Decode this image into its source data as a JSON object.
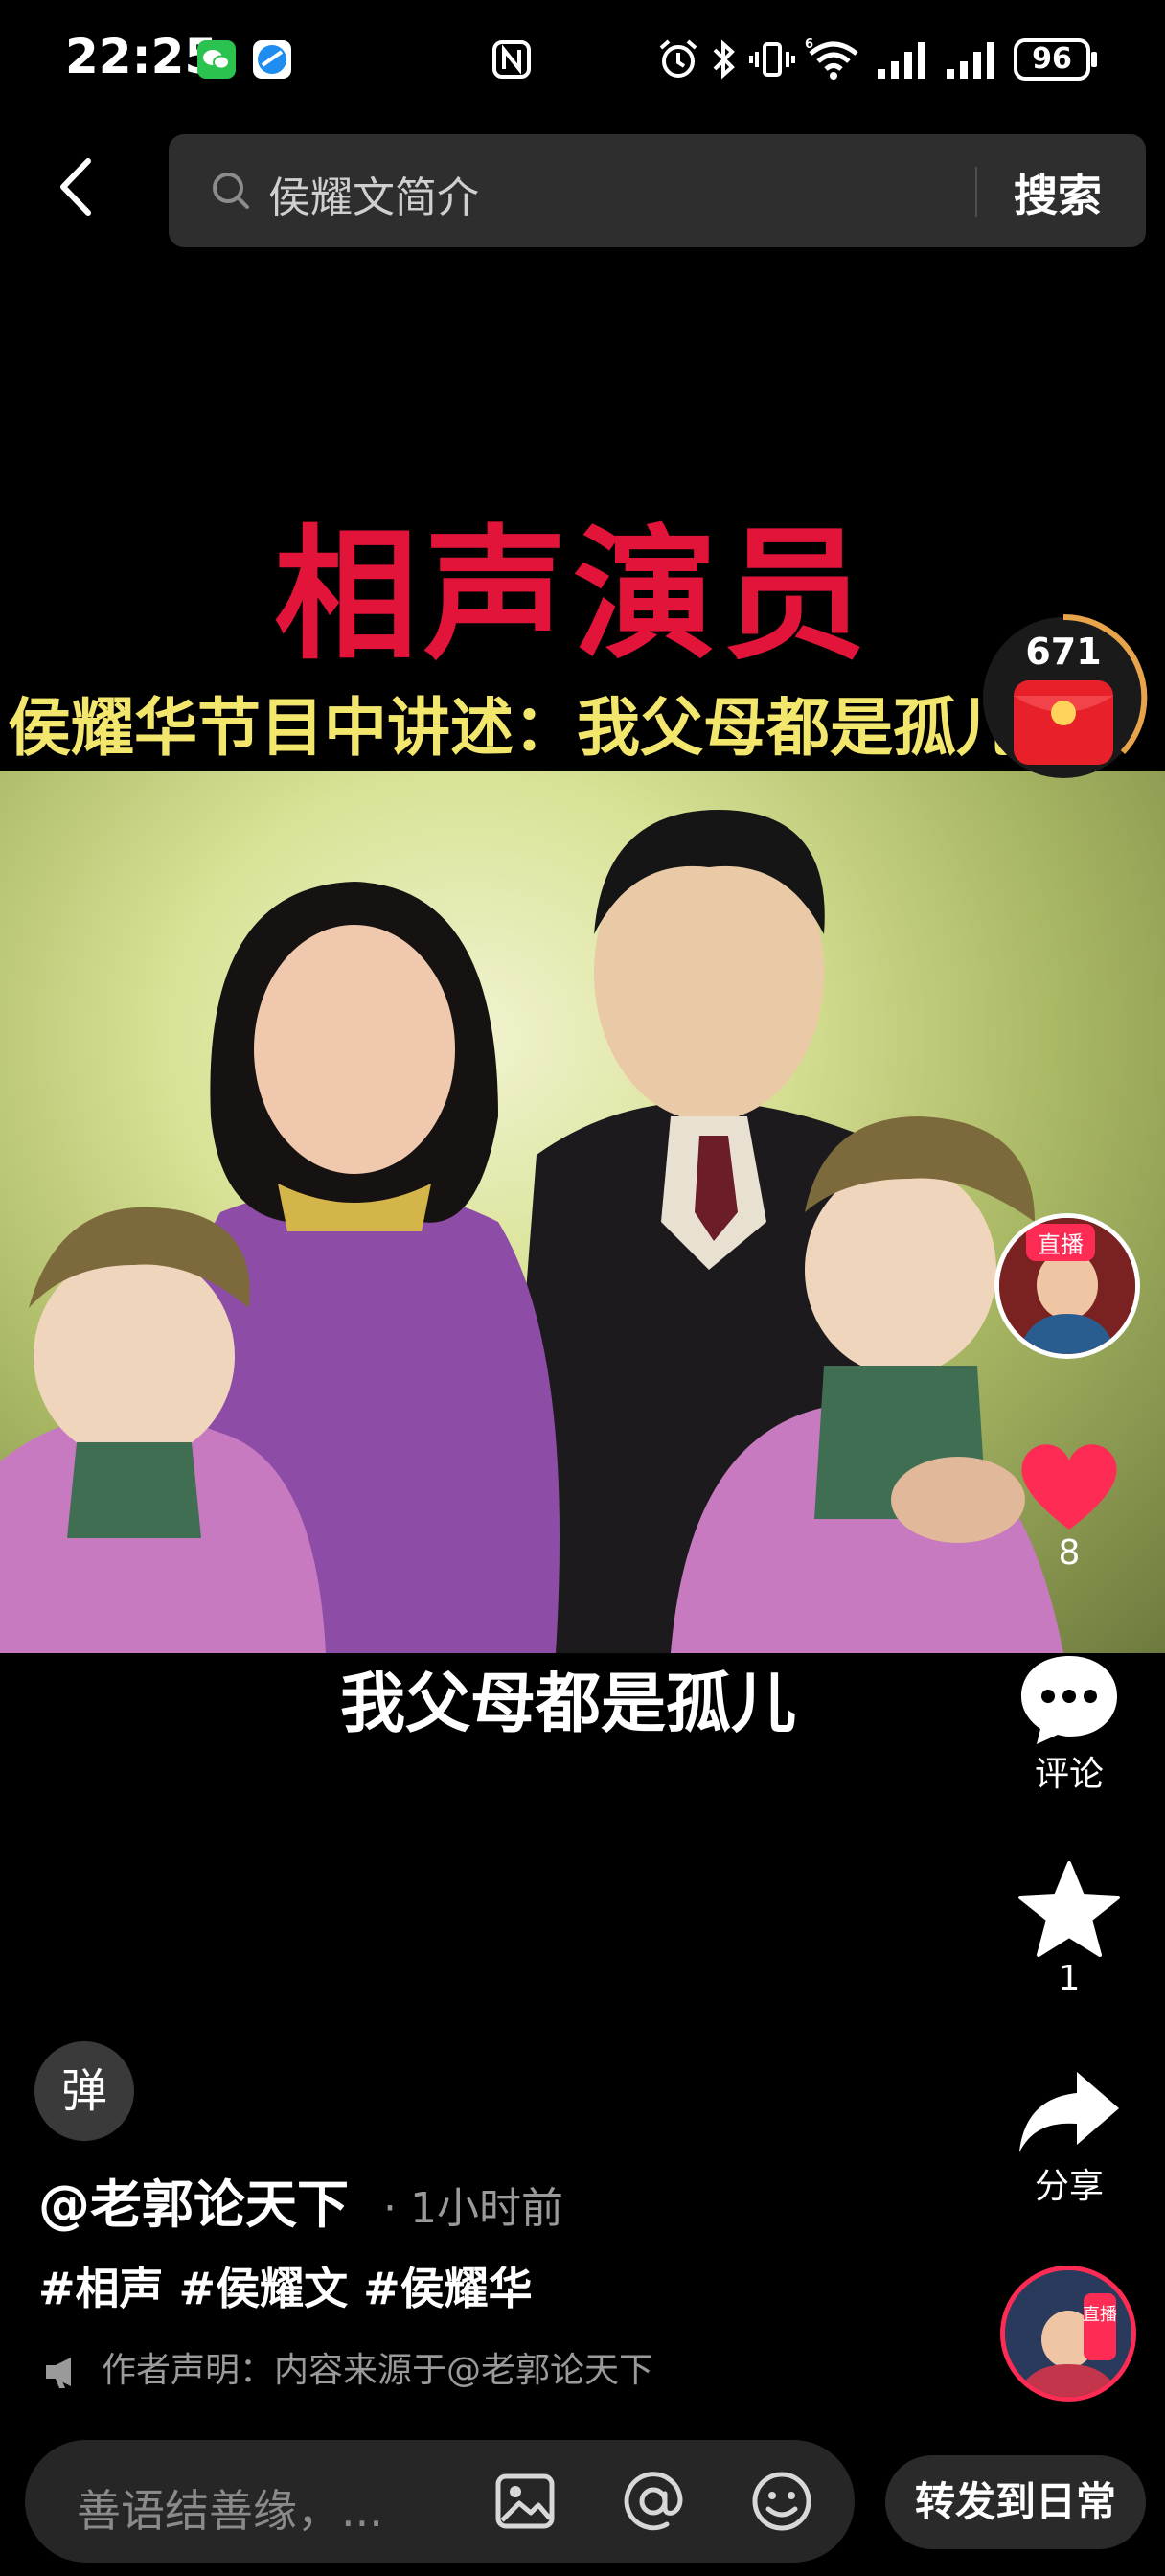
{
  "status_bar": {
    "time": "22:25",
    "battery": "96"
  },
  "search": {
    "query": "侯耀文简介",
    "button": "搜索"
  },
  "video": {
    "red_title": "相声演员",
    "yellow_title": "侯耀华节目中讲述：我父母都是孤儿",
    "subtitle": "我父母都是孤儿"
  },
  "side_actions": {
    "red_packet_count": "671",
    "live_tag": "直播",
    "likes": "8",
    "comment_label": "评论",
    "favorites": "1",
    "share_label": "分享",
    "live_tag_2": "直播"
  },
  "info": {
    "danmu_label": "弹",
    "author": "@老郭论天下",
    "time_ago": "· 1小时前",
    "tags": "#相声 #侯耀文 #侯耀华",
    "statement": "作者声明：内容来源于@老郭论天下"
  },
  "comment_bar": {
    "placeholder": "善语结善缘，...",
    "forward_button": "转发到日常"
  },
  "colors": {
    "accent_red": "#fe2c55",
    "title_red": "#e3143a",
    "title_yellow": "#f3e66d"
  }
}
